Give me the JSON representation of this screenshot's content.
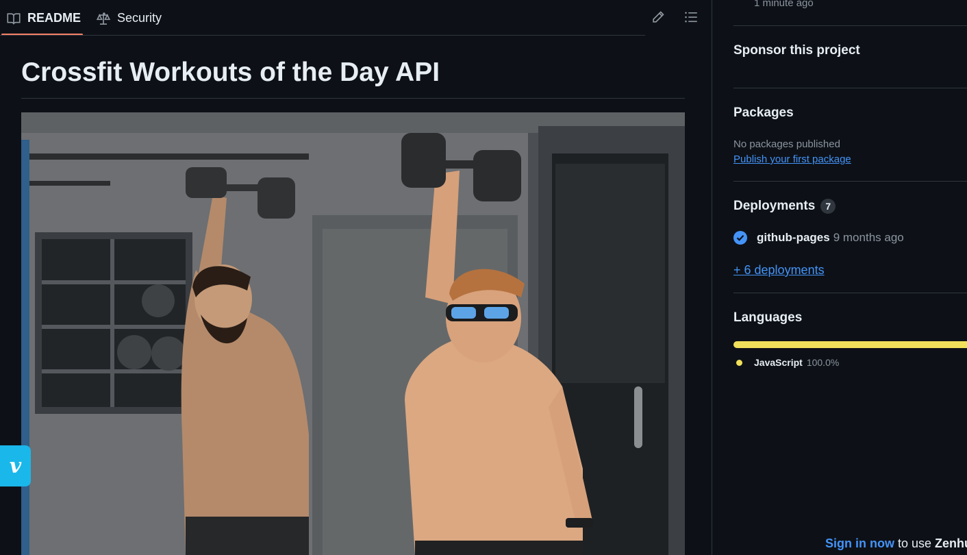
{
  "tabs": {
    "readme_label": "README",
    "security_label": "Security"
  },
  "readme": {
    "title": "Crossfit Workouts of the Day API",
    "image_alt": "Two shirtless athletes doing overhead dumbbell presses"
  },
  "vimeo": {
    "glyph": "v"
  },
  "sidebar": {
    "last_updated": "1 minute ago",
    "sponsor": {
      "heading": "Sponsor this project"
    },
    "packages": {
      "heading": "Packages",
      "empty_text": "No packages published",
      "publish_link": "Publish your first package"
    },
    "deployments": {
      "heading": "Deployments",
      "count": "7",
      "items": [
        {
          "name": "github-pages",
          "when": "9 months ago",
          "status": "success"
        }
      ],
      "more_link": "+ 6 deployments"
    },
    "languages": {
      "heading": "Languages",
      "items": [
        {
          "name": "JavaScript",
          "percent": "100.0%",
          "color": "#f1e05a",
          "share": 1.0
        }
      ]
    },
    "zenhub": {
      "link": "Sign in now",
      "text": " to use ",
      "brand": "Zenhub"
    }
  },
  "colors": {
    "background": "#0d1117",
    "border": "#30363d",
    "link": "#4493f8",
    "tab_underline": "#f78166",
    "muted": "#8b949e"
  }
}
